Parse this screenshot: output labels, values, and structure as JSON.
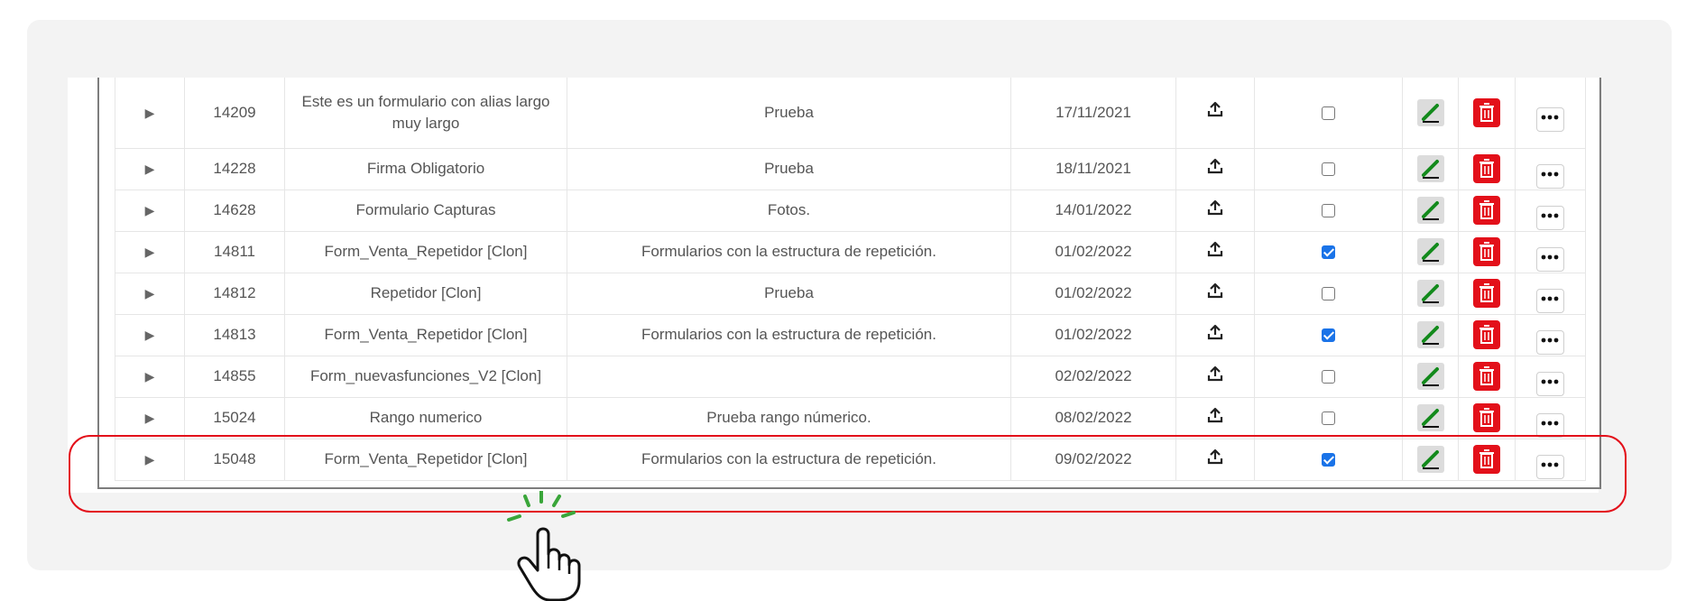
{
  "rows": [
    {
      "id": "14209",
      "name": "Este es un formulario con alias largo muy largo",
      "description": "Prueba",
      "date": "17/11/2021",
      "checked": false
    },
    {
      "id": "14228",
      "name": "Firma Obligatorio",
      "description": "Prueba",
      "date": "18/11/2021",
      "checked": false
    },
    {
      "id": "14628",
      "name": "Formulario Capturas",
      "description": "Fotos.",
      "date": "14/01/2022",
      "checked": false
    },
    {
      "id": "14811",
      "name": "Form_Venta_Repetidor [Clon]",
      "description": "Formularios con la estructura de repetición.",
      "date": "01/02/2022",
      "checked": true
    },
    {
      "id": "14812",
      "name": "Repetidor [Clon]",
      "description": "Prueba",
      "date": "01/02/2022",
      "checked": false
    },
    {
      "id": "14813",
      "name": "Form_Venta_Repetidor [Clon]",
      "description": "Formularios con la estructura de repetición.",
      "date": "01/02/2022",
      "checked": true
    },
    {
      "id": "14855",
      "name": "Form_nuevasfunciones_V2 [Clon]",
      "description": "",
      "date": "02/02/2022",
      "checked": false
    },
    {
      "id": "15024",
      "name": "Rango numerico",
      "description": "Prueba rango númerico.",
      "date": "08/02/2022",
      "checked": false
    },
    {
      "id": "15048",
      "name": "Form_Venta_Repetidor [Clon]",
      "description": "Formularios con la estructura de repetición.",
      "date": "09/02/2022",
      "checked": true
    }
  ],
  "icons": {
    "expand": "expand-arrow-icon",
    "upload": "upload-icon",
    "edit": "pencil-icon",
    "delete": "trash-icon",
    "more": "more-dots-icon",
    "hand": "hand-pointer-icon"
  },
  "colors": {
    "delete_bg": "#e3101a",
    "edit_pencil": "#138a1c",
    "checkbox_on": "#1a73e8",
    "highlight": "#e3101a",
    "hand_accent": "#3aa63a"
  }
}
